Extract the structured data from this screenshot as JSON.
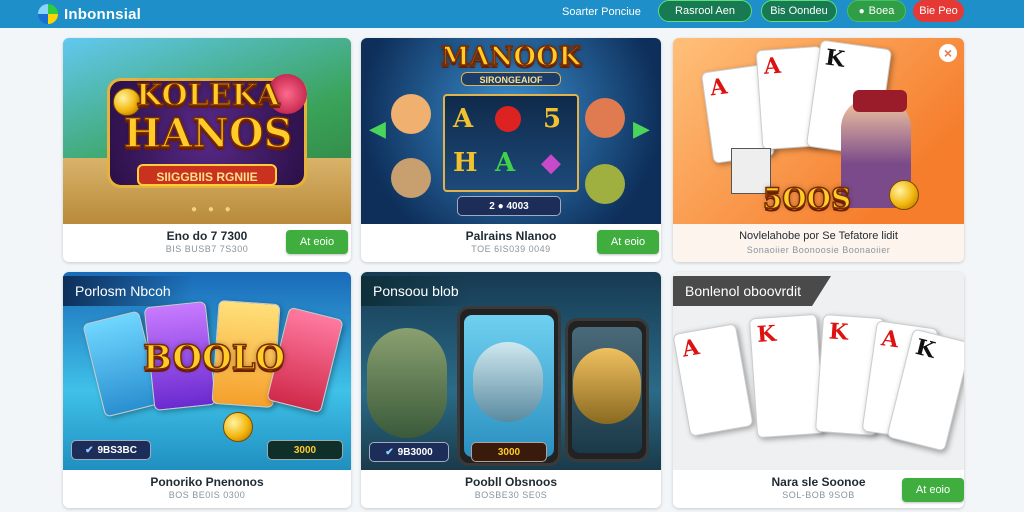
{
  "header": {
    "logo_text": "Inbonnsial",
    "nav_link": "Soarter Ponciue",
    "btn_outline": "Rasrool Aen",
    "btn_outline2": "Bis Oondeu",
    "btn_green": "Boea",
    "btn_red": "Bie Peo"
  },
  "cards": [
    {
      "art_word1": "KOLEKA",
      "art_word2": "HANOS",
      "art_ribbon": "SIIGGBIIS RGNIIE",
      "title": "Eno do 7 7300",
      "sub": "BIS BUSB7 7S300",
      "button": "At eoio"
    },
    {
      "art_word": "MANOOK",
      "art_ribbon": "SIRONGEAIOF",
      "art_counter": "2 ● 4003",
      "title": "Palrains Nlanoo",
      "sub": "TOE 6IS039 0049",
      "button": "At eoio"
    },
    {
      "art_badge": "5OOS",
      "title": "Novlelahobe por Se Tefatore lidit",
      "sub": "Sonaoiier  Boonoosie  Boonaoiier",
      "close": "×"
    },
    {
      "tag": "Porlosm Nbcoh",
      "art_word": "BOOLO",
      "art_left": "9BS3BC",
      "art_right": "3000",
      "title": "Ponoriko Pnenonos",
      "sub": "BOS BE0IS 0300",
      "button": ""
    },
    {
      "tag": "Ponsoou blob",
      "art_left": "9B3000",
      "art_right": "3000",
      "title": "Poobll Obsnoos",
      "sub": "BOSBE30 SE0S",
      "button": ""
    },
    {
      "tag": "Bonlenol oboovrdit",
      "title": "Nara sle Soonoe",
      "sub": "SOL-BOB 9SOB",
      "button": "At eoio"
    }
  ],
  "colors": {
    "header": "#1e8fc8",
    "play_green": "#3fae3e",
    "danger": "#e53935"
  }
}
